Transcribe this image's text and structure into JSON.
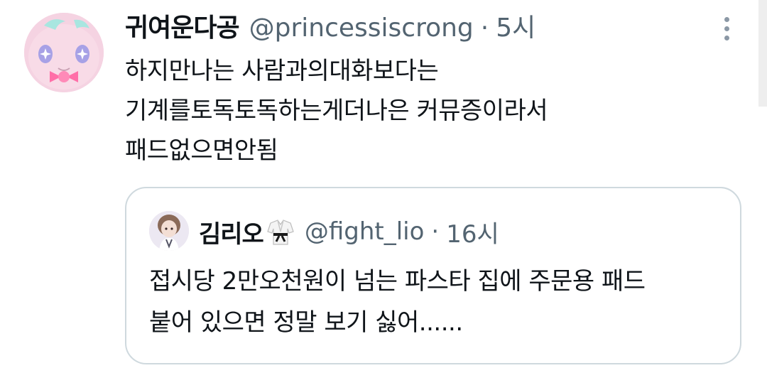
{
  "tweet": {
    "author": {
      "display_name": "귀여운다공",
      "handle": "@princessiscrong",
      "time": "5시",
      "separator": "·"
    },
    "body_lines": [
      "하지만나는 사람과의대화보다는",
      "기계를토독토독하는게더나은 커뮤증이라서",
      "패드없으면안됨"
    ],
    "more_icon": "more-vertical-icon"
  },
  "quote": {
    "author": {
      "display_name": "김리오",
      "emoji_icon": "martial-arts-uniform-icon",
      "handle": "@fight_lio",
      "time": "16시",
      "separator": "·"
    },
    "body_lines": [
      "접시당 2만오천원이 넘는 파스타 집에 주문용 패드",
      "붙어 있으면 정말 보기 싫어......"
    ]
  },
  "colors": {
    "text_primary": "#0f1419",
    "text_secondary": "#536471",
    "border": "#cfd9de",
    "avatar_bg": "#f6d6e4"
  }
}
